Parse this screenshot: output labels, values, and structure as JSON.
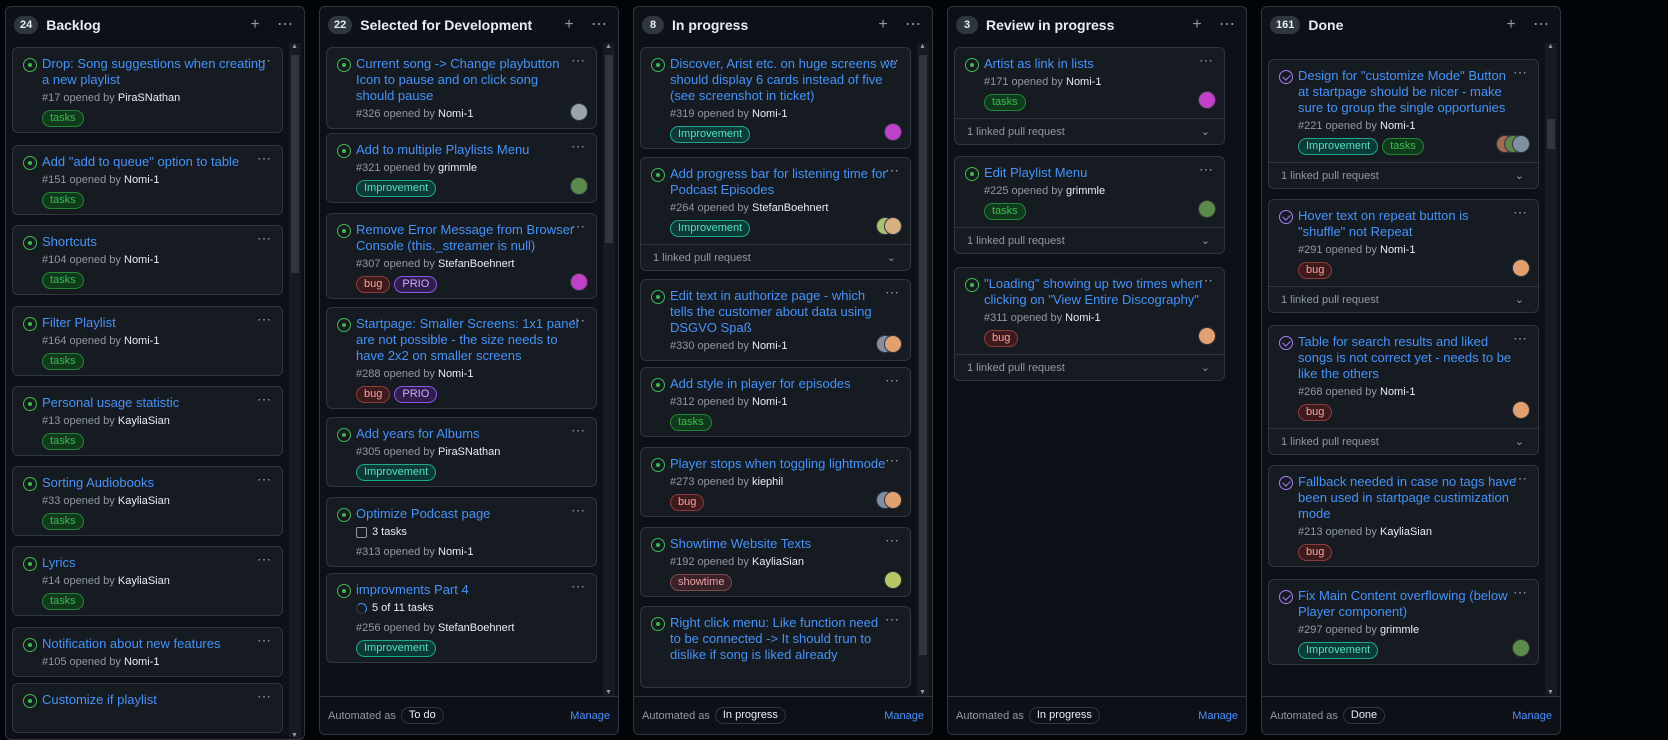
{
  "colors": {
    "bg": "#010409",
    "column": "#0d1117",
    "card": "#161b22",
    "border": "#30363d",
    "link": "#4493f8",
    "open": "#3fb950",
    "closed": "#ab7df8",
    "muted": "#9198a1"
  },
  "label_styles": {
    "tasks": {
      "fg": "#3fb950",
      "bg": "#0f3a1c",
      "bd": "#238636"
    },
    "Improvement": {
      "fg": "#4ee0c6",
      "bg": "#0b3b36",
      "bd": "#19a890"
    },
    "bug": {
      "fg": "#ffa198",
      "bg": "#3d1a1c",
      "bd": "#8e3b3b"
    },
    "PRIO": {
      "fg": "#d2a8ff",
      "bg": "#311d4b",
      "bd": "#8957e5"
    },
    "showtime": {
      "fg": "#e8a0a8",
      "bg": "#3a2228",
      "bd": "#7d4a52"
    }
  },
  "columns": [
    {
      "count": "24",
      "title": "Backlog",
      "footer": null,
      "cards": [
        {
          "title_lines": [
            "Drop: Song suggestions when creating",
            "a new playlist"
          ],
          "number": "#17",
          "by": "PiraSNathan",
          "labels": [
            "tasks"
          ]
        },
        {
          "title_lines": [
            "Add \"add to queue\" option to table"
          ],
          "number": "#151",
          "by": "Nomi-1",
          "labels": [
            "tasks"
          ]
        },
        {
          "title_lines": [
            "Shortcuts"
          ],
          "number": "#104",
          "by": "Nomi-1",
          "labels": [
            "tasks"
          ]
        },
        {
          "title_lines": [
            "Filter Playlist"
          ],
          "number": "#164",
          "by": "Nomi-1",
          "labels": [
            "tasks"
          ]
        },
        {
          "title_lines": [
            "Personal usage statistic"
          ],
          "number": "#13",
          "by": "KayliaSian",
          "labels": [
            "tasks"
          ]
        },
        {
          "title_lines": [
            "Sorting Audiobooks"
          ],
          "number": "#33",
          "by": "KayliaSian",
          "labels": [
            "tasks"
          ]
        },
        {
          "title_lines": [
            "Lyrics"
          ],
          "number": "#14",
          "by": "KayliaSian",
          "labels": [
            "tasks"
          ]
        },
        {
          "title_lines": [
            "Notification about new features"
          ],
          "number": "#105",
          "by": "Nomi-1",
          "labels": []
        },
        {
          "title_lines": [
            "Customize if playlist"
          ],
          "number": "",
          "by": "",
          "labels": []
        }
      ]
    },
    {
      "count": "22",
      "title": "Selected for Development",
      "footer": {
        "automated": "Automated as",
        "state": "To do",
        "manage": "Manage"
      },
      "cards": [
        {
          "title_lines": [
            "Current song -> Change playbutton",
            "Icon to pause and on click song",
            "should pause"
          ],
          "number": "#326",
          "by": "Nomi-1",
          "labels": [],
          "avatars": [
            "#9aa4ad"
          ]
        },
        {
          "title_lines": [
            "Add to multiple Playlists Menu"
          ],
          "number": "#321",
          "by": "grimmle",
          "labels": [
            "Improvement"
          ],
          "avatars": [
            "#5b8a4a"
          ]
        },
        {
          "title_lines": [
            "Remove Error Message from Browser",
            "Console (this._streamer is null)"
          ],
          "number": "#307",
          "by": "StefanBoehnert",
          "labels": [
            "bug",
            "PRIO"
          ],
          "avatars": [
            "#c040c8"
          ]
        },
        {
          "title_lines": [
            "Startpage: Smaller Screens: 1x1 panel",
            "are not possible - the size needs to",
            "have 2x2 on smaller screens"
          ],
          "number": "#288",
          "by": "Nomi-1",
          "labels": [
            "bug",
            "PRIO"
          ]
        },
        {
          "title_lines": [
            "Add years for Albums"
          ],
          "number": "#305",
          "by": "PiraSNathan",
          "labels": [
            "Improvement"
          ]
        },
        {
          "title_lines": [
            "Optimize Podcast page"
          ],
          "tasks": "3 tasks",
          "task_kind": "list",
          "number": "#313",
          "by": "Nomi-1",
          "labels": []
        },
        {
          "title_lines": [
            "improvments Part 4"
          ],
          "tasks": "5 of 11 tasks",
          "task_kind": "progress",
          "number": "#256",
          "by": "StefanBoehnert",
          "labels": [
            "Improvement"
          ]
        }
      ]
    },
    {
      "count": "8",
      "title": "In progress",
      "footer": {
        "automated": "Automated as",
        "state": "In progress",
        "manage": "Manage"
      },
      "cards": [
        {
          "title_lines": [
            "Discover, Arist etc. on huge screens we",
            "should display 6 cards instead of five",
            "(see screenshot in ticket)"
          ],
          "number": "#319",
          "by": "Nomi-1",
          "labels": [
            "Improvement"
          ],
          "avatars": [
            "#c040c8"
          ]
        },
        {
          "title_lines": [
            "Add progress bar for listening time for",
            "Podcast Episodes"
          ],
          "number": "#264",
          "by": "StefanBoehnert",
          "labels": [
            "Improvement"
          ],
          "avatars": [
            "#d8b080",
            "#a8c070"
          ],
          "linked": "1 linked pull request"
        },
        {
          "title_lines": [
            "Edit text in authorize page - which",
            "tells the customer about data using",
            "DSGVO Spaß"
          ],
          "number": "#330",
          "by": "Nomi-1",
          "labels": [],
          "avatars": [
            "#e0a070",
            "#8090a0"
          ]
        },
        {
          "title_lines": [
            "Add style in player for episodes"
          ],
          "number": "#312",
          "by": "Nomi-1",
          "labels": [
            "tasks"
          ]
        },
        {
          "title_lines": [
            "Player stops when toggling lightmode"
          ],
          "number": "#273",
          "by": "kiephil",
          "labels": [
            "bug"
          ],
          "avatars": [
            "#e0a070",
            "#8090a0"
          ]
        },
        {
          "title_lines": [
            "Showtime Website Texts"
          ],
          "number": "#192",
          "by": "KayliaSian",
          "labels": [
            "showtime"
          ],
          "avatars": [
            "#b8c860"
          ]
        },
        {
          "title_lines": [
            "Right click menu: Like function need",
            "to be connected -> It should trun to",
            "dislike if song is liked already"
          ],
          "number": "",
          "by": "",
          "labels": []
        }
      ]
    },
    {
      "count": "3",
      "title": "Review in progress",
      "footer": {
        "automated": "Automated as",
        "state": "In progress",
        "manage": "Manage"
      },
      "cards": [
        {
          "title_lines": [
            "Artist as link in lists"
          ],
          "number": "#171",
          "by": "Nomi-1",
          "labels": [
            "tasks"
          ],
          "avatars": [
            "#c040c8"
          ],
          "linked": "1 linked pull request"
        },
        {
          "title_lines": [
            "Edit Playlist Menu"
          ],
          "number": "#225",
          "by": "grimmle",
          "labels": [
            "tasks"
          ],
          "avatars": [
            "#5b8a4a"
          ],
          "linked": "1 linked pull request"
        },
        {
          "title_lines": [
            "\"Loading\" showing up two times when",
            "clicking on \"View Entire Discography\""
          ],
          "number": "#311",
          "by": "Nomi-1",
          "labels": [
            "bug"
          ],
          "avatars": [
            "#e0a070"
          ],
          "linked": "1 linked pull request"
        }
      ]
    },
    {
      "count": "161",
      "title": "Done",
      "footer": {
        "automated": "Automated as",
        "state": "Done",
        "manage": "Manage"
      },
      "cards": [
        {
          "title_lines": [
            "Design for \"customize Mode\" Button",
            "at startpage should be nicer - make",
            "sure to group the single opportunies"
          ],
          "number": "#221",
          "by": "Nomi-1",
          "labels": [
            "Improvement",
            "tasks"
          ],
          "avatars": [
            "#8090a0",
            "#5b8a4a",
            "#a06a50"
          ],
          "linked": "1 linked pull request",
          "closed": true
        },
        {
          "title_lines": [
            "Hover text on repeat button is",
            "\"shuffle\" not Repeat"
          ],
          "number": "#291",
          "by": "Nomi-1",
          "labels": [
            "bug"
          ],
          "avatars": [
            "#e0a070"
          ],
          "linked": "1 linked pull request",
          "closed": true
        },
        {
          "title_lines": [
            "Table for search results and liked",
            "songs is not correct yet - needs to be",
            "like the others"
          ],
          "number": "#268",
          "by": "Nomi-1",
          "labels": [
            "bug"
          ],
          "avatars": [
            "#e0a070"
          ],
          "linked": "1 linked pull request",
          "closed": true
        },
        {
          "title_lines": [
            "Fallback needed in case no tags have",
            "been used in startpage custimization",
            "mode"
          ],
          "number": "#213",
          "by": "KayliaSian",
          "labels": [
            "bug"
          ],
          "closed": true
        },
        {
          "title_lines": [
            "Fix Main Content overflowing (below",
            "Player component)"
          ],
          "number": "#297",
          "by": "grimmle",
          "labels": [
            "Improvement"
          ],
          "avatars": [
            "#5b8a4a"
          ],
          "closed": true
        }
      ]
    }
  ],
  "opened_by_text": "opened by"
}
